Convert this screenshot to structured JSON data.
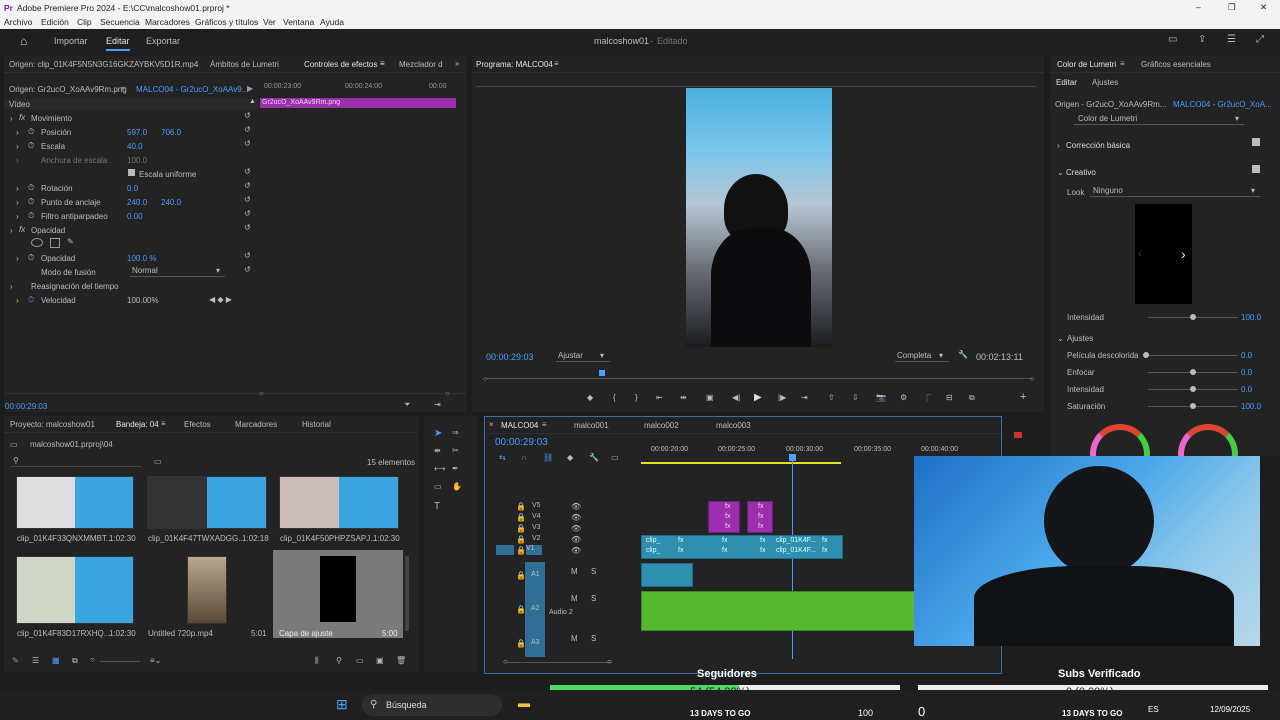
{
  "window": {
    "title": "Adobe Premiere Pro 2024 - E:\\CC\\malcoshow01.prproj *",
    "controls": [
      "–",
      "❐",
      "✕"
    ]
  },
  "menu": [
    "Archivo",
    "Edición",
    "Clip",
    "Secuencia",
    "Marcadores",
    "Gráficos y títulos",
    "Ver",
    "Ventana",
    "Ayuda"
  ],
  "workspace": {
    "tabs": [
      "Importar",
      "Editar",
      "Exportar"
    ],
    "active": "Editar",
    "project_status": "malcoshow01",
    "edit_status": "Editado"
  },
  "source_panel": {
    "tabs": [
      "Origen: clip_01K4F5N5N3G16GKZAYBKV5D1R.mp4",
      "Ámbitos de Lumetri",
      "Controles de efectos",
      "Mezclador d"
    ],
    "origin": "Origen: Gr2ucO_XoAAv9Rm.png",
    "sequence": "MALCO04 - Gr2ucO_XoAAv9...",
    "time_marks": [
      "00:00:23:00",
      "00:00:24:00",
      "00:00"
    ],
    "clip_label": "Gr2ucO_XoAAv9Rm.png",
    "section_video": "Vídeo",
    "movimiento": "Movimiento",
    "posicion_label": "Posición",
    "posicion_x": "597.0",
    "posicion_y": "706.0",
    "escala_label": "Escala",
    "escala_val": "40.0",
    "anchura_label": "Anchura de escala",
    "anchura_val": "100.0",
    "escala_uniforme": "Escala uniforme",
    "rotacion_label": "Rotación",
    "rotacion_val": "0.0",
    "anclaje_label": "Punto de anclaje",
    "anclaje_x": "240.0",
    "anclaje_y": "240.0",
    "antiparpadeo_label": "Filtro antiparpadeo",
    "antiparpadeo_val": "0.00",
    "opacidad_section": "Opacidad",
    "opacidad_label": "Opacidad",
    "opacidad_val": "100.0 %",
    "fusion_label": "Modo de fusión",
    "fusion_val": "Normal",
    "reasignacion": "Reasignación del tiempo",
    "velocidad_label": "Velocidad",
    "velocidad_val": "100.00%",
    "timecode": "00:00:29:03"
  },
  "program_panel": {
    "title": "Programa: MALCO04",
    "timecode": "00:00:29:03",
    "fit": "Ajustar",
    "quality": "Completa",
    "duration": "00:02:13:11"
  },
  "lumetri_panel": {
    "tabs": [
      "Color de Lumetri",
      "Gráficos esenciales"
    ],
    "subtabs": [
      "Editar",
      "Ajustes"
    ],
    "origin": "Origen - Gr2ucO_XoAAv9Rm...",
    "sequence": "MALCO04 - Gr2ucO_XoA...",
    "effect": "Color de Lumetri",
    "basic": "Corrección básica",
    "creative": "Creativo",
    "look_label": "Look",
    "look_val": "Ninguno",
    "intensity_label": "Intensidad",
    "intensity_val": "100.0",
    "ajustes": "Ajustes",
    "faded_label": "Película descolorida",
    "faded_val": "0.0",
    "sharpen_label": "Enfocar",
    "sharpen_val": "0.0",
    "vib_label": "Intensidad",
    "vib_val": "0.0",
    "sat_label": "Saturación",
    "sat_val": "100.0"
  },
  "project_panel": {
    "tabs": [
      "Proyecto: malcoshow01",
      "Bandeja: 04",
      "Efectos",
      "Marcadores",
      "Historial"
    ],
    "file": "malcoshow01.prproj\\04",
    "count": "15 elementos",
    "items": [
      {
        "name": "clip_01K4F33QNXMMBT...",
        "dur": "1:02:30"
      },
      {
        "name": "clip_01K4F47TWXADGG...",
        "dur": "1:02:18"
      },
      {
        "name": "clip_01K4F50PHPZSAPJ...",
        "dur": "1:02:30"
      },
      {
        "name": "clip_01K4F83D17RXHQ...",
        "dur": "1:02:30"
      },
      {
        "name": "Untitled 720p.mp4",
        "dur": "5:01"
      },
      {
        "name": "Capa de ajuste",
        "dur": "5:00"
      }
    ]
  },
  "timeline": {
    "tabs": [
      "MALCO04",
      "malco001",
      "malco002",
      "malco003"
    ],
    "timecode": "00:00:29:03",
    "ruler": [
      "00:00:20:00",
      "00:00:25:00",
      "00:00:30:00",
      "00:00:35:00",
      "00:00:40:00"
    ],
    "video_tracks": [
      "V5",
      "V4",
      "V3",
      "V2",
      "V1"
    ],
    "audio_tracks": [
      "A1",
      "A2",
      "A3"
    ],
    "audio2_name": "Audio 2",
    "clip_v2": "clip_01K4F...",
    "clip_v1": "clip_01K4F...",
    "clip_short": "clip_",
    "fx": "fx"
  },
  "overlay": {
    "seguidores_label": "Seguidores",
    "seguidores_val": "54 (54.00%)",
    "seguidores_progress": 0.54,
    "subs_label": "Subs Verificado",
    "subs_val": "0 (0.00%)",
    "subs_progress": 0,
    "countdown": "13 DAYS TO GO"
  },
  "taskbar": {
    "search": "Búsqueda",
    "lang": "ES",
    "date": "12/09/2025",
    "num1": "100",
    "num2": "0"
  },
  "colors": {
    "accent": "#4a9eff",
    "clip_blue": "#2f8fae",
    "clip_purple": "#9b2fae",
    "clip_green": "#55b82e",
    "label_purple": "#9b2fae"
  }
}
